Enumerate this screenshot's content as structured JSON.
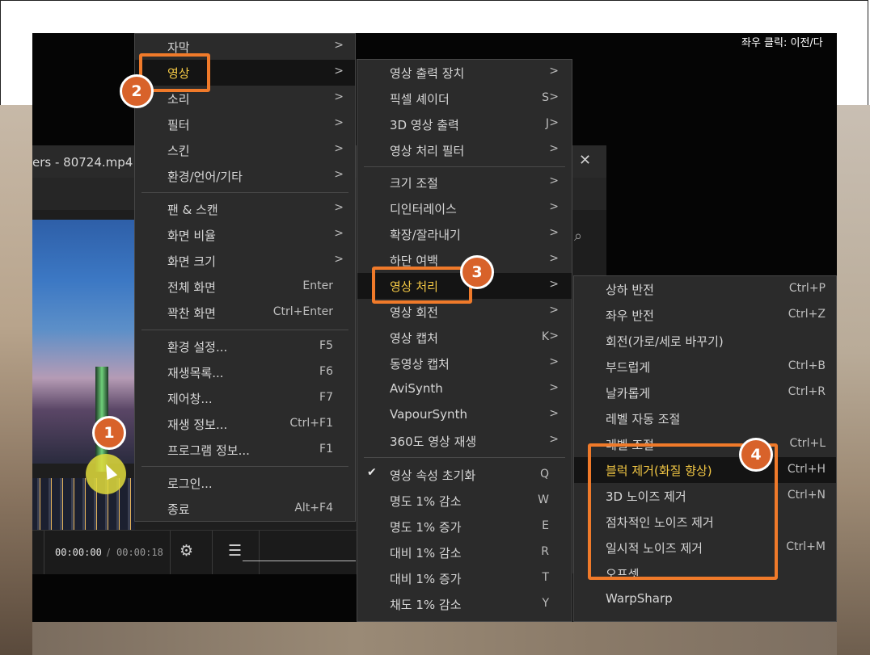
{
  "hint": "좌우 클릭: 이전/다",
  "player": {
    "title": "ers - 80724.mp4",
    "close": "✕",
    "time_current": "00:00:00",
    "time_separator": "/",
    "time_total": "00:00:18",
    "settings_glyph": "⚙",
    "menu_glyph": "☰",
    "search_glyph": "🔍"
  },
  "main_menu": [
    {
      "label": "자막",
      "arrow": ">"
    },
    {
      "label": "영상",
      "arrow": ">"
    },
    {
      "label": "소리",
      "arrow": ">"
    },
    {
      "label": "필터",
      "arrow": ">"
    },
    {
      "label": "스킨",
      "arrow": ">"
    },
    {
      "label": "환경/언어/기타",
      "arrow": ">"
    },
    {
      "label": "팬 & 스캔",
      "arrow": ">"
    },
    {
      "label": "화면 비율",
      "arrow": ">"
    },
    {
      "label": "화면 크기",
      "arrow": ">"
    },
    {
      "label": "전체 화면",
      "shortcut": "Enter"
    },
    {
      "label": "꽉찬 화면",
      "shortcut": "Ctrl+Enter"
    },
    {
      "label": "환경 설정...",
      "shortcut": "F5"
    },
    {
      "label": "재생목록...",
      "shortcut": "F6"
    },
    {
      "label": "제어창...",
      "shortcut": "F7"
    },
    {
      "label": "재생 정보...",
      "shortcut": "Ctrl+F1"
    },
    {
      "label": "프로그램 정보...",
      "shortcut": "F1"
    },
    {
      "label": "로그인..."
    },
    {
      "label": "종료",
      "shortcut": "Alt+F4"
    }
  ],
  "video_menu": [
    {
      "label": "영상 출력 장치",
      "arrow": ">"
    },
    {
      "label": "픽셀 셰이더",
      "shortcut": "S",
      "arrow": ">"
    },
    {
      "label": "3D 영상 출력",
      "shortcut": "J",
      "arrow": ">"
    },
    {
      "label": "영상 처리 필터",
      "arrow": ">"
    },
    {
      "label": "크기 조절",
      "arrow": ">"
    },
    {
      "label": "디인터레이스",
      "arrow": ">"
    },
    {
      "label": "확장/잘라내기",
      "arrow": ">"
    },
    {
      "label": "하단 여백",
      "arrow": ">"
    },
    {
      "label": "영상 처리",
      "arrow": ">"
    },
    {
      "label": "영상 회전",
      "arrow": ">"
    },
    {
      "label": "영상 캡처",
      "shortcut": "K",
      "arrow": ">"
    },
    {
      "label": "동영상 캡처",
      "arrow": ">"
    },
    {
      "label": "AviSynth",
      "arrow": ">"
    },
    {
      "label": "VapourSynth",
      "arrow": ">"
    },
    {
      "label": "360도 영상 재생",
      "arrow": ">"
    },
    {
      "label": "영상 속성 초기화",
      "shortcut": "Q",
      "check": "✔"
    },
    {
      "label": "명도 1% 감소",
      "shortcut": "W"
    },
    {
      "label": "명도 1% 증가",
      "shortcut": "E"
    },
    {
      "label": "대비 1% 감소",
      "shortcut": "R"
    },
    {
      "label": "대비 1% 증가",
      "shortcut": "T"
    },
    {
      "label": "채도 1% 감소",
      "shortcut": "Y"
    }
  ],
  "process_menu": [
    {
      "label": "상하 반전",
      "shortcut": "Ctrl+P"
    },
    {
      "label": "좌우 반전",
      "shortcut": "Ctrl+Z"
    },
    {
      "label": "회전(가로/세로 바꾸기)"
    },
    {
      "label": "부드럽게",
      "shortcut": "Ctrl+B"
    },
    {
      "label": "날카롭게",
      "shortcut": "Ctrl+R"
    },
    {
      "label": "레벨 자동 조절"
    },
    {
      "label": "레벨 조절",
      "shortcut": "Ctrl+L"
    },
    {
      "label": "블럭 제거(화질 향상)",
      "shortcut": "Ctrl+H"
    },
    {
      "label": "3D 노이즈 제거",
      "shortcut": "Ctrl+N"
    },
    {
      "label": "점차적인 노이즈 제거"
    },
    {
      "label": "일시적 노이즈 제거",
      "shortcut": "Ctrl+M"
    },
    {
      "label": "오프셋"
    },
    {
      "label": "WarpSharp"
    }
  ],
  "badges": [
    "1",
    "2",
    "3",
    "4"
  ]
}
